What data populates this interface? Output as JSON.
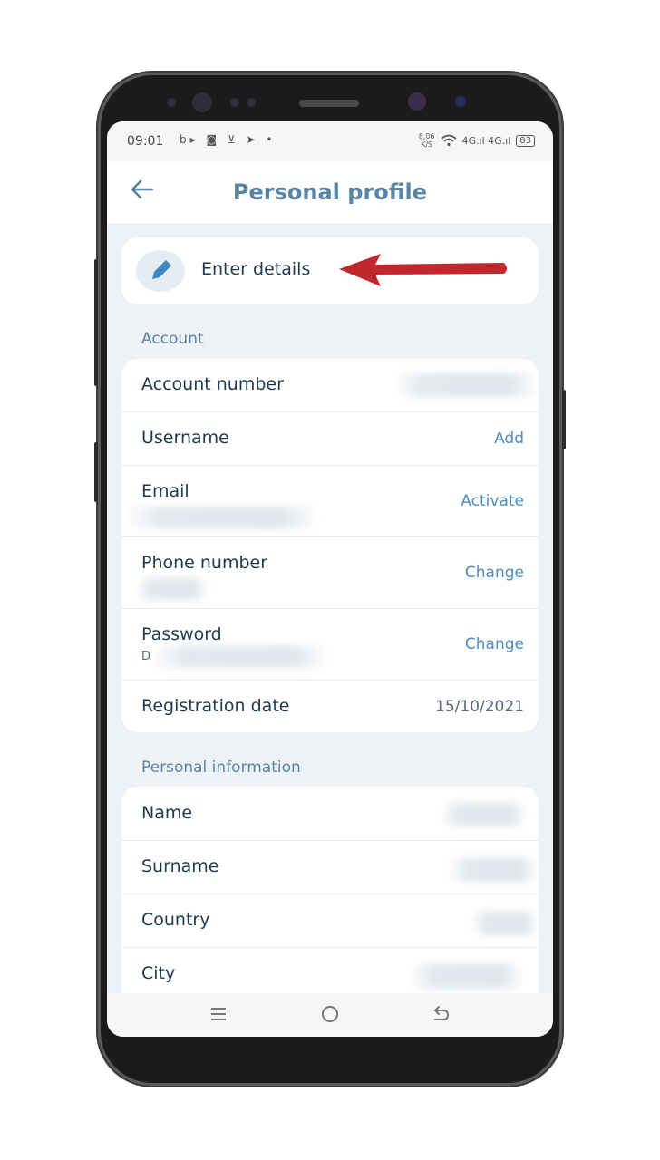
{
  "status": {
    "time": "09:01",
    "left_icons": "b▸ ◙ ⊻ ➤ •",
    "net_speed": "8,06",
    "net_unit": "K/S",
    "signal": "4G.ıl 4G.ıl",
    "battery": "83"
  },
  "appbar": {
    "title": "Personal profile"
  },
  "enter": {
    "label": "Enter details"
  },
  "account": {
    "section": "Account",
    "rows": [
      {
        "label": "Account number"
      },
      {
        "label": "Username",
        "action": "Add"
      },
      {
        "label": "Email",
        "action": "Activate"
      },
      {
        "label": "Phone number",
        "action": "Change"
      },
      {
        "label": "Password",
        "hint": "D",
        "action": "Change"
      },
      {
        "label": "Registration date",
        "value": "15/10/2021"
      }
    ]
  },
  "personal": {
    "section": "Personal information",
    "rows": [
      {
        "label": "Name"
      },
      {
        "label": "Surname"
      },
      {
        "label": "Country"
      },
      {
        "label": "City"
      }
    ]
  },
  "colors": {
    "accent": "#4e8cc2",
    "title": "#5b84a3",
    "arrow": "#c0282d"
  },
  "icons": [
    "back-arrow-icon",
    "pencil-icon",
    "menu-icon",
    "home-icon",
    "back-icon"
  ]
}
